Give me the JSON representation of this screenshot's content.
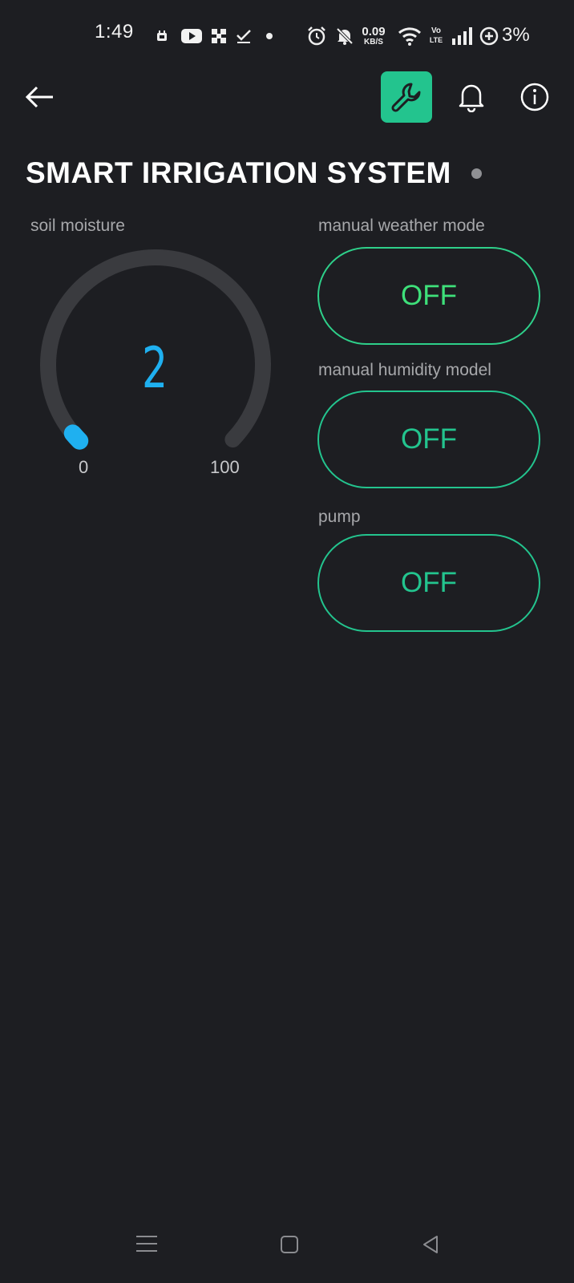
{
  "status_bar": {
    "time": "1:49",
    "net_speed_value": "0.09",
    "net_speed_unit": "KB/S",
    "volte_top": "Vo",
    "volte_bottom": "LTE",
    "battery": "3%",
    "icons": [
      "notification-icon",
      "youtube-icon",
      "app-icon",
      "check-icon",
      "dot-icon",
      "alarm-icon",
      "mute-icon",
      "wifi-icon",
      "volte-icon",
      "signal-icon",
      "battery-saver-icon"
    ]
  },
  "header": {
    "icons": [
      "back-arrow-icon",
      "wrench-icon",
      "bell-icon",
      "info-icon"
    ]
  },
  "title": "SMART IRRIGATION SYSTEM",
  "gauge": {
    "label": "soil moisture",
    "value": "2",
    "min": "0",
    "max": "100",
    "level": 0.02,
    "color": "#1fb0f0"
  },
  "switches": [
    {
      "label": "manual weather mode",
      "state": "OFF"
    },
    {
      "label": "manual humidity model",
      "state": "OFF"
    },
    {
      "label": "pump",
      "state": "OFF"
    }
  ],
  "colors": {
    "background": "#1d1e22",
    "accent": "#23c48e",
    "gauge_track": "#3a3b3f"
  },
  "nav_bar": {
    "icons": [
      "menu-icon",
      "home-icon",
      "back-icon"
    ]
  }
}
